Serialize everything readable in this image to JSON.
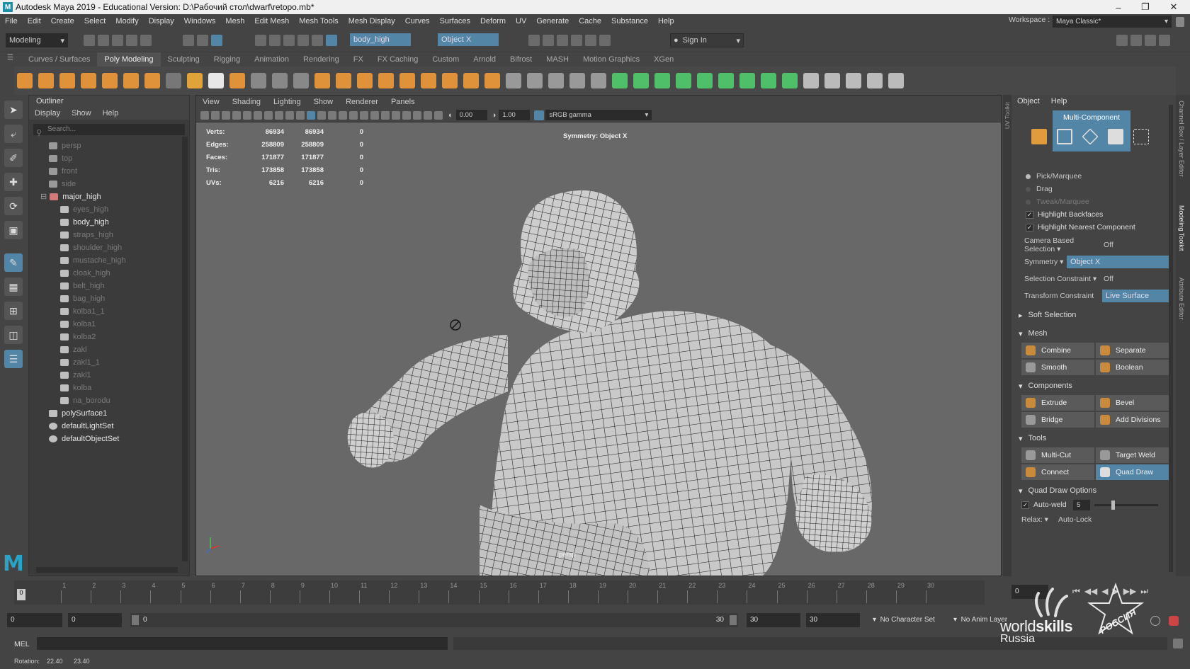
{
  "title": "Autodesk Maya 2019 - Educational Version: D:\\Рабочий стол\\dwarf\\retopo.mb*",
  "menu": [
    "File",
    "Edit",
    "Create",
    "Select",
    "Modify",
    "Display",
    "Windows",
    "Mesh",
    "Edit Mesh",
    "Mesh Tools",
    "Mesh Display",
    "Curves",
    "Surfaces",
    "Deform",
    "UV",
    "Generate",
    "Cache",
    "Substance",
    "Help"
  ],
  "workspace": {
    "label": "Workspace :",
    "value": "Maya Classic*"
  },
  "status": {
    "mode": "Modeling",
    "object_field": "body_high",
    "symmetry_field": "Object X",
    "sign_in": "Sign In"
  },
  "shelf_tabs": [
    "Curves / Surfaces",
    "Poly Modeling",
    "Sculpting",
    "Rigging",
    "Animation",
    "Rendering",
    "FX",
    "FX Caching",
    "Custom",
    "Arnold",
    "Bifrost",
    "MASH",
    "Motion Graphics",
    "XGen"
  ],
  "outliner": {
    "title": "Outliner",
    "menu": [
      "Display",
      "Show",
      "Help"
    ],
    "search_placeholder": "Search...",
    "items": [
      {
        "label": "persp",
        "indent": 1,
        "dim": true,
        "icon": "camera"
      },
      {
        "label": "top",
        "indent": 1,
        "dim": true,
        "icon": "camera"
      },
      {
        "label": "front",
        "indent": 1,
        "dim": true,
        "icon": "camera"
      },
      {
        "label": "side",
        "indent": 1,
        "dim": true,
        "icon": "camera"
      },
      {
        "label": "major_high",
        "indent": 0,
        "dim": false,
        "icon": "group"
      },
      {
        "label": "eyes_high",
        "indent": 2,
        "dim": true,
        "icon": "mesh"
      },
      {
        "label": "body_high",
        "indent": 2,
        "dim": false,
        "icon": "mesh"
      },
      {
        "label": "straps_high",
        "indent": 2,
        "dim": true,
        "icon": "mesh"
      },
      {
        "label": "shoulder_high",
        "indent": 2,
        "dim": true,
        "icon": "mesh"
      },
      {
        "label": "mustache_high",
        "indent": 2,
        "dim": true,
        "icon": "mesh"
      },
      {
        "label": "cloak_high",
        "indent": 2,
        "dim": true,
        "icon": "mesh"
      },
      {
        "label": "belt_high",
        "indent": 2,
        "dim": true,
        "icon": "mesh"
      },
      {
        "label": "bag_high",
        "indent": 2,
        "dim": true,
        "icon": "mesh"
      },
      {
        "label": "kolba1_1",
        "indent": 2,
        "dim": true,
        "icon": "mesh"
      },
      {
        "label": "kolba1",
        "indent": 2,
        "dim": true,
        "icon": "mesh"
      },
      {
        "label": "kolba2",
        "indent": 2,
        "dim": true,
        "icon": "mesh"
      },
      {
        "label": "zakl",
        "indent": 2,
        "dim": true,
        "icon": "mesh"
      },
      {
        "label": "zakl1_1",
        "indent": 2,
        "dim": true,
        "icon": "mesh"
      },
      {
        "label": "zakl1",
        "indent": 2,
        "dim": true,
        "icon": "mesh"
      },
      {
        "label": "kolba",
        "indent": 2,
        "dim": true,
        "icon": "mesh"
      },
      {
        "label": "na_borodu",
        "indent": 2,
        "dim": true,
        "icon": "mesh"
      },
      {
        "label": "polySurface1",
        "indent": 1,
        "dim": false,
        "icon": "mesh"
      },
      {
        "label": "defaultLightSet",
        "indent": 1,
        "dim": false,
        "icon": "set"
      },
      {
        "label": "defaultObjectSet",
        "indent": 1,
        "dim": false,
        "icon": "set"
      }
    ]
  },
  "viewport": {
    "menu": [
      "View",
      "Shading",
      "Lighting",
      "Show",
      "Renderer",
      "Panels"
    ],
    "exposure": "0.00",
    "gamma": "1.00",
    "colorspace": "sRGB gamma",
    "symmetry_label": "Symmetry: Object X",
    "camera_label": "persp",
    "hud": [
      {
        "label": "Verts:",
        "a": "86934",
        "b": "86934",
        "c": "0"
      },
      {
        "label": "Edges:",
        "a": "258809",
        "b": "258809",
        "c": "0"
      },
      {
        "label": "Faces:",
        "a": "171877",
        "b": "171877",
        "c": "0"
      },
      {
        "label": "Tris:",
        "a": "173858",
        "b": "173858",
        "c": "0"
      },
      {
        "label": "UVs:",
        "a": "6216",
        "b": "6216",
        "c": "0"
      }
    ]
  },
  "toolkit": {
    "menu": [
      "Object",
      "Help"
    ],
    "multi_component": "Multi-Component",
    "pick_modes": [
      "Pick/Marquee",
      "Drag",
      "Tweak/Marquee"
    ],
    "highlight_backfaces": "Highlight Backfaces",
    "highlight_nearest": "Highlight Nearest Component",
    "camera_based": {
      "label": "Camera Based Selection",
      "value": "Off"
    },
    "symmetry": {
      "label": "Symmetry",
      "value": "Object X"
    },
    "selection_constraint": {
      "label": "Selection Constraint",
      "value": "Off"
    },
    "transform_constraint": {
      "label": "Transform Constraint",
      "value": "Live Surface"
    },
    "soft_selection": "Soft Selection",
    "mesh_section": "Mesh",
    "mesh_buttons": [
      "Combine",
      "Separate",
      "Smooth",
      "Boolean"
    ],
    "components_section": "Components",
    "components_buttons": [
      "Extrude",
      "Bevel",
      "Bridge",
      "Add Divisions"
    ],
    "tools_section": "Tools",
    "tools_buttons": [
      "Multi-Cut",
      "Target Weld",
      "Connect",
      "Quad Draw"
    ],
    "quad_draw_options": "Quad Draw Options",
    "auto_weld": {
      "label": "Auto-weld",
      "value": "5"
    },
    "relax": {
      "label": "Relax:",
      "value": "Auto-Lock"
    }
  },
  "side_tabs": [
    "Channel Box / Layer Editor",
    "Modeling Toolkit",
    "Attribute Editor"
  ],
  "uv_toolkit_tab": "UV Toolkit",
  "timeline": {
    "ticks": [
      "0",
      "1",
      "2",
      "3",
      "4",
      "5",
      "6",
      "7",
      "8",
      "9",
      "10",
      "11",
      "12",
      "13",
      "14",
      "15",
      "16",
      "17",
      "18",
      "19",
      "20",
      "21",
      "22",
      "23",
      "24",
      "25",
      "26",
      "27",
      "28",
      "29",
      "30"
    ],
    "current_frame": "0"
  },
  "range": {
    "start": "0",
    "inner_start": "0",
    "slider_start": "0",
    "slider_end": "30",
    "inner_end": "30",
    "end": "30",
    "character_set": "No Character Set",
    "anim_layer": "No Anim Layer"
  },
  "mel": {
    "label": "MEL"
  },
  "help_line": {
    "label": "Rotation:",
    "x": "22.40",
    "y": "23.40"
  },
  "watermark": {
    "brand1": "world",
    "brand2": "skills",
    "country": "Russia",
    "stamp": "РОССИЯ"
  },
  "colors": {
    "accent": "#5285a6",
    "panel": "#444444",
    "viewport": "#686868",
    "mesh": "#c9c9c9"
  }
}
